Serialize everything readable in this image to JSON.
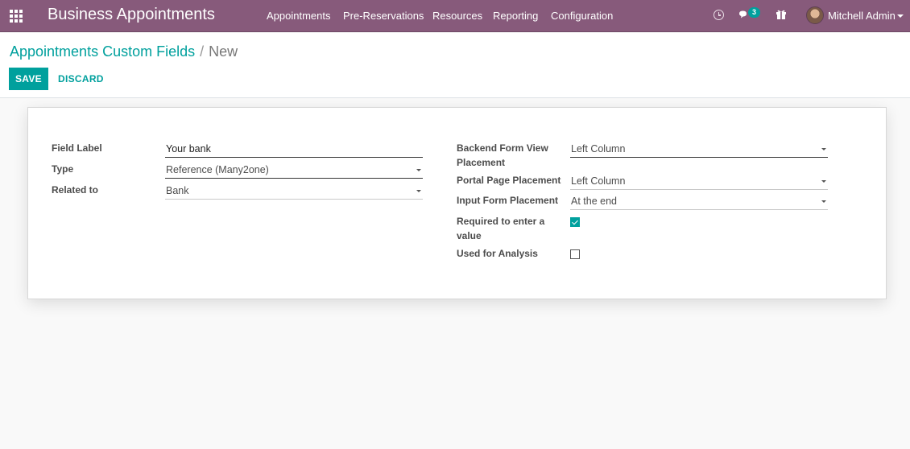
{
  "navbar": {
    "app_title": "Business Appointments",
    "menu": [
      "Appointments",
      "Pre-Reservations",
      "Resources",
      "Reporting",
      "Configuration"
    ],
    "messages_count": "3",
    "user_name": "Mitchell Admin",
    "background_color": "#875a7b"
  },
  "breadcrumb": {
    "parent": "Appointments Custom Fields",
    "separator": "/",
    "current": "New"
  },
  "buttons": {
    "save": "SAVE",
    "discard": "DISCARD"
  },
  "form": {
    "left": {
      "field_label": {
        "label": "Field Label",
        "value": "Your bank"
      },
      "type": {
        "label": "Type",
        "value": "Reference (Many2one)"
      },
      "related_to": {
        "label": "Related to",
        "value": "Bank"
      }
    },
    "right": {
      "backend_placement": {
        "label_line1": "Backend Form View",
        "label_line2": "Placement",
        "value": "Left Column"
      },
      "portal_placement": {
        "label": "Portal Page Placement",
        "value": "Left Column"
      },
      "input_placement": {
        "label": "Input Form Placement",
        "value": "At the end"
      },
      "required": {
        "label_line1": "Required to enter a",
        "label_line2": "value",
        "checked": true
      },
      "analysis": {
        "label": "Used for Analysis",
        "checked": false
      }
    }
  },
  "accent_color": "#00a09d"
}
